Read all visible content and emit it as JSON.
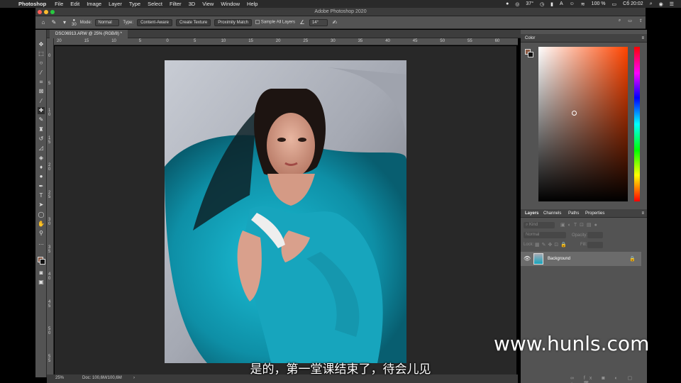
{
  "menubar": {
    "items": [
      "Photoshop",
      "File",
      "Edit",
      "Image",
      "Layer",
      "Type",
      "Select",
      "Filter",
      "3D",
      "View",
      "Window",
      "Help"
    ],
    "temperature": "37°",
    "battery": "100 %",
    "clock": "Сб 20:02"
  },
  "window": {
    "title": "Adobe Photoshop 2020"
  },
  "options": {
    "brush_size": "30",
    "mode_label": "Mode:",
    "mode_value": "Normal",
    "type_label": "Type:",
    "type_content_aware": "Content-Aware",
    "type_create_texture": "Create Texture",
    "type_proximity_match": "Proximity Match",
    "sample_all_layers": "Sample All Layers",
    "angle": "14°"
  },
  "document": {
    "tab_title": "DSC06913.ARW @ 25% (RGB/8) *",
    "zoom": "25%",
    "doc_size": "Doc: 100,6M/100,6M",
    "ruler_h": [
      "20",
      "15",
      "10",
      "5",
      "0",
      "5",
      "10",
      "15",
      "20",
      "25",
      "30",
      "35",
      "40",
      "45",
      "50",
      "55",
      "60"
    ],
    "ruler_v": [
      "0",
      "5",
      "1 0",
      "1 5",
      "2 0",
      "2 5",
      "3 0",
      "3 5",
      "4 0",
      "4 5",
      "5 0",
      "5 5"
    ]
  },
  "panels": {
    "color_title": "Color",
    "layers_tabs": [
      "Layers",
      "Channels",
      "Paths",
      "Properties"
    ],
    "kind_placeholder": "Kind",
    "blend_mode": "Normal",
    "opacity_label": "Opacity:",
    "lock_label": "Lock:",
    "fill_label": "Fill:",
    "layer_name": "Background"
  },
  "overlay": {
    "subtitle": "是的，第一堂课结束了，待会儿见",
    "watermark": "www.hunls.com"
  },
  "colors": {
    "foreground": "#8a5a44",
    "background": "#111111",
    "accent_teal": "#16a6bd"
  }
}
